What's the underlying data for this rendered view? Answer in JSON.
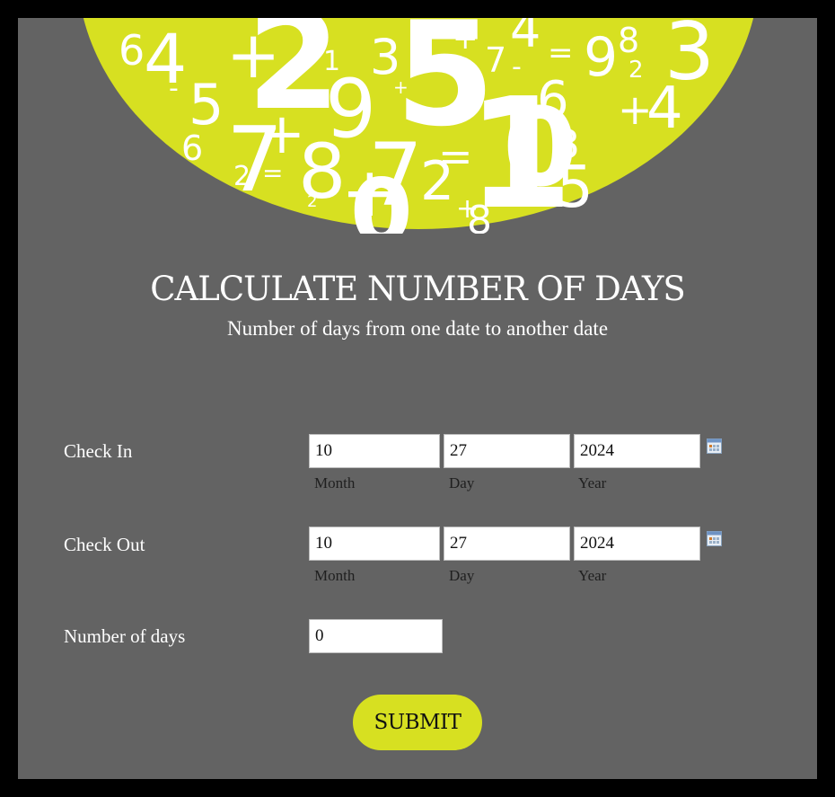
{
  "header": {
    "title": "CALCULATE NUMBER OF DAYS",
    "subtitle": "Number of days from one date to another date"
  },
  "form": {
    "check_in": {
      "label": "Check In",
      "month": "10",
      "day": "27",
      "year": "2024",
      "month_label": "Month",
      "day_label": "Day",
      "year_label": "Year"
    },
    "check_out": {
      "label": "Check Out",
      "month": "10",
      "day": "27",
      "year": "2024",
      "month_label": "Month",
      "day_label": "Day",
      "year_label": "Year"
    },
    "number_of_days": {
      "label": "Number of days",
      "value": "0"
    },
    "submit_label": "SUBMIT"
  },
  "icons": {
    "calendar": "calendar-icon"
  },
  "colors": {
    "accent": "#d7e021",
    "panel": "#636363",
    "border": "#000000"
  }
}
